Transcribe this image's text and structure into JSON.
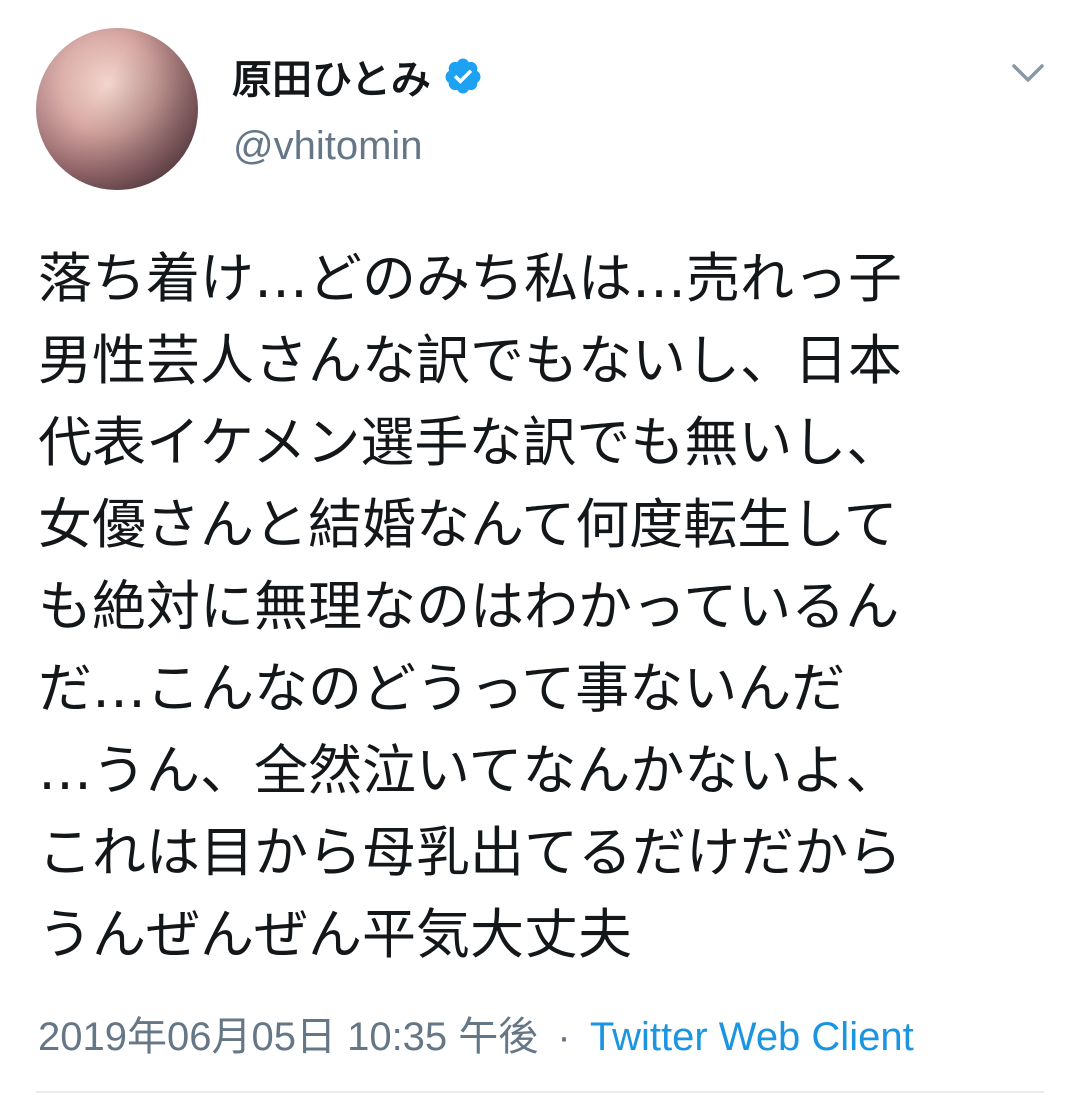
{
  "user": {
    "display_name": "原田ひとみ",
    "handle": "@vhitomin",
    "verified": true
  },
  "icons": {
    "avatar": "profile-avatar",
    "verified": "verified-badge-icon",
    "menu": "chevron-down-icon"
  },
  "tweet": {
    "lines": [
      "落ち着け…どのみち私は…売れっ子",
      "男性芸人さんな訳でもないし、日本",
      "代表イケメン選手な訳でも無いし、",
      "女優さんと結婚なんて何度転生して",
      "も絶対に無理なのはわかっているん",
      "だ…こんなのどうって事ないんだ",
      "…うん、全然泣いてなんかないよ、",
      "これは目から母乳出てるだけだから",
      "うんぜんぜん平気大丈夫"
    ]
  },
  "meta": {
    "timestamp": "2019年06月05日 10:35 午後",
    "separator": "·",
    "source": "Twitter Web Client"
  },
  "colors": {
    "text": "#14171a",
    "secondary": "#657786",
    "link": "#1b95e0",
    "verified": "#1da1f2",
    "divider": "#e6ecf0"
  }
}
